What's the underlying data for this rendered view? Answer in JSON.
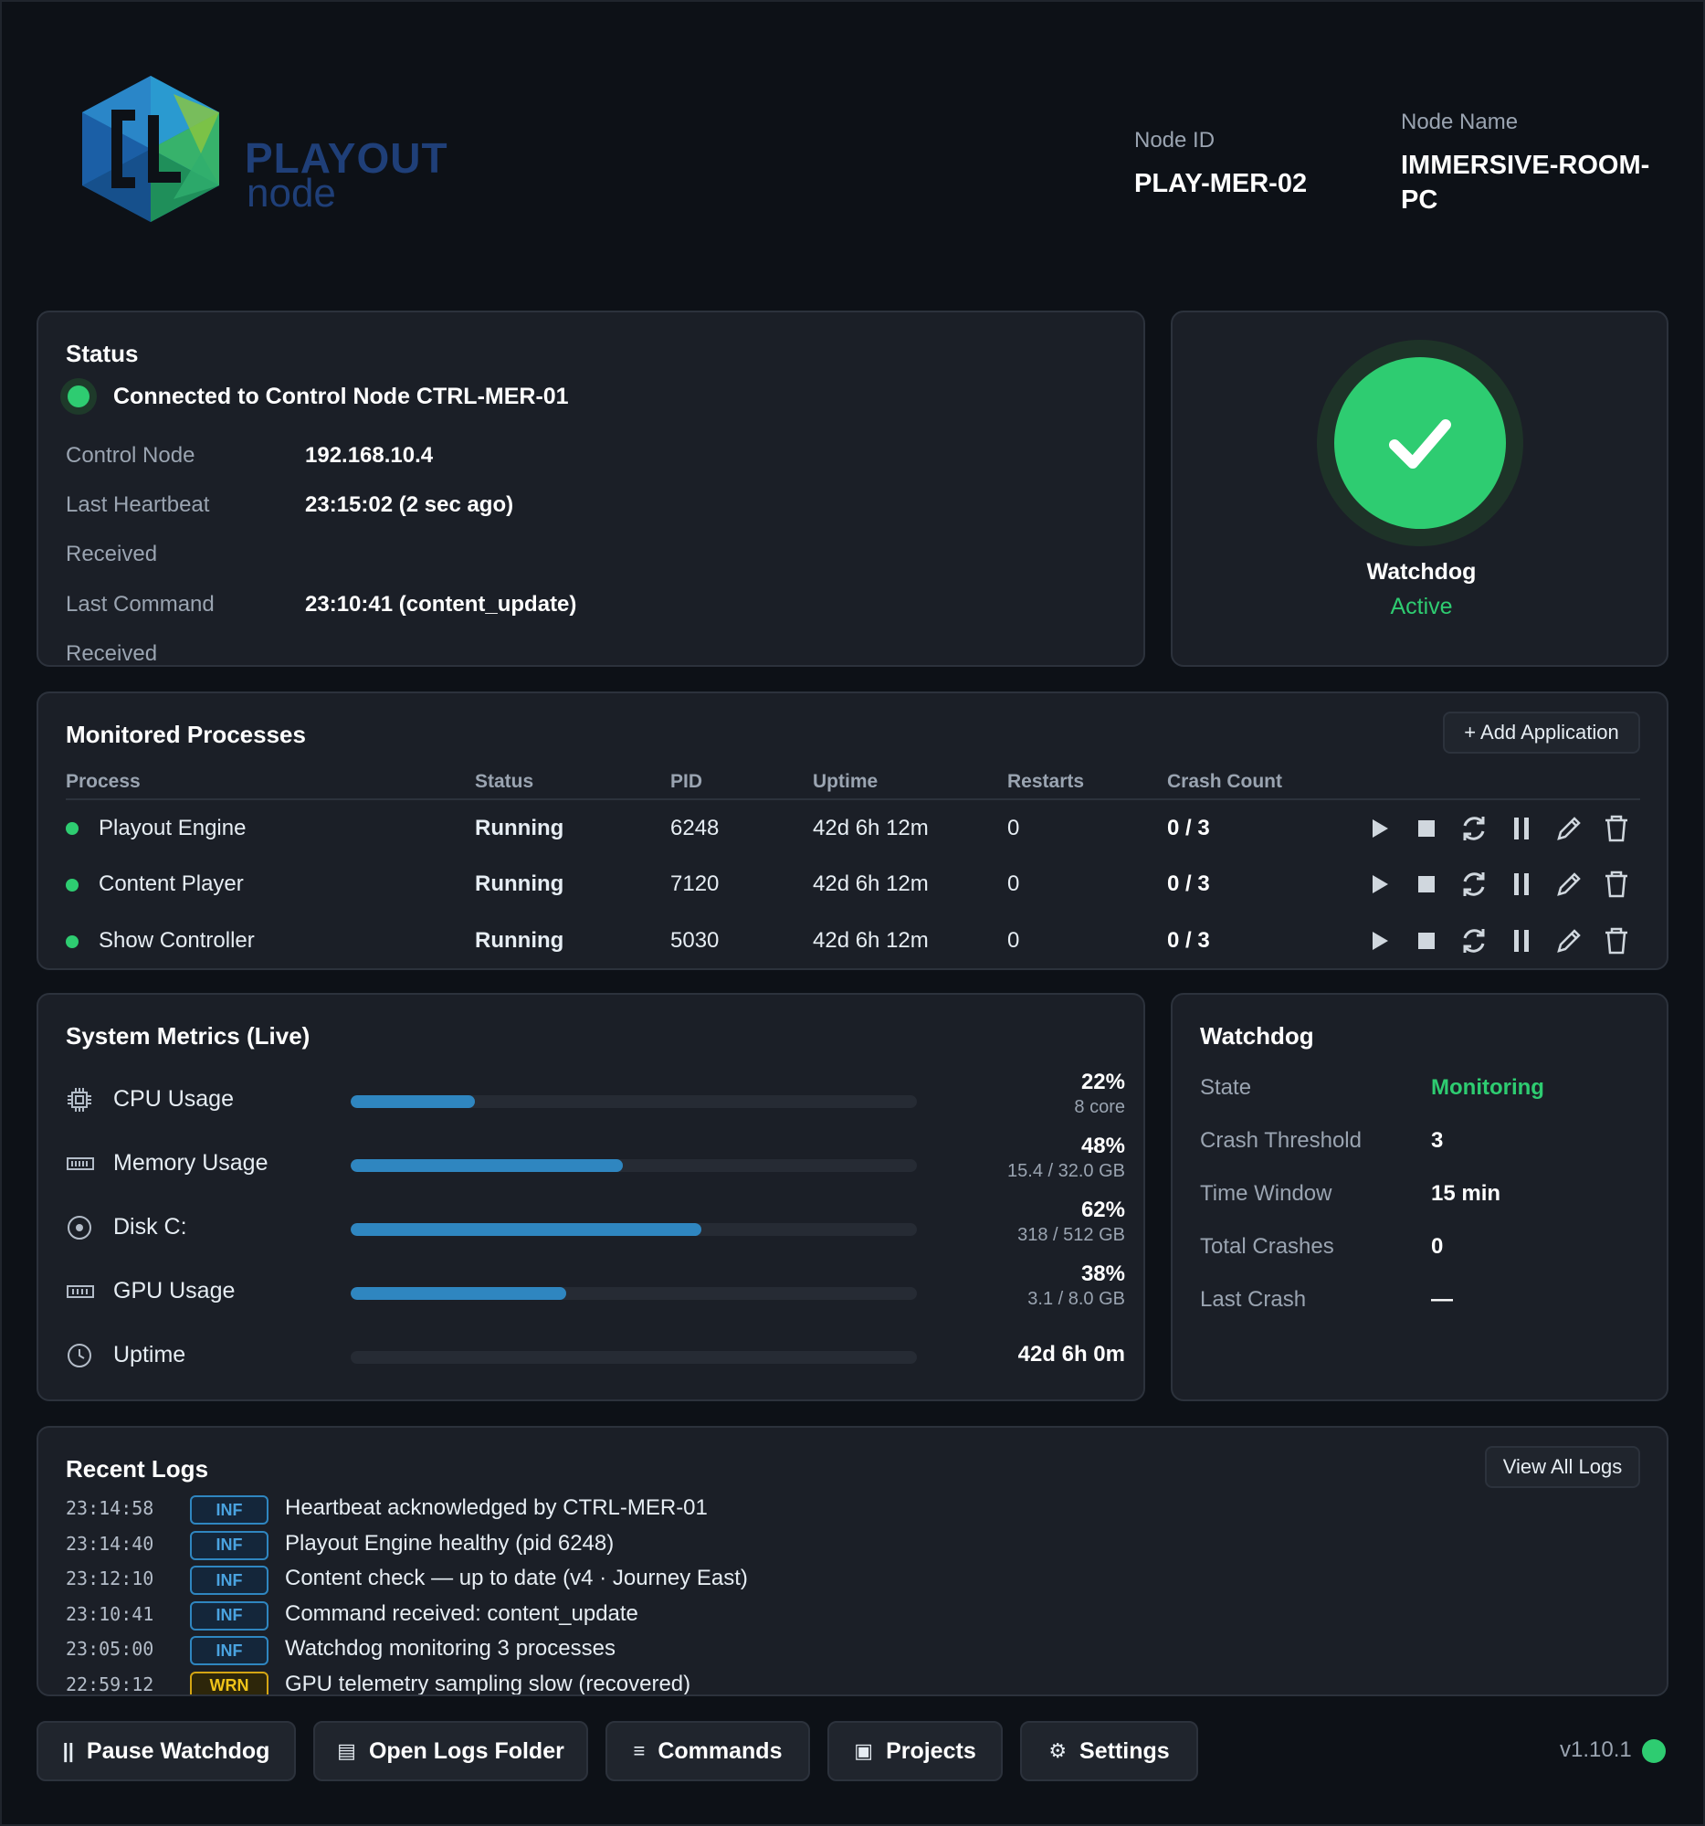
{
  "header": {
    "logo_word": "PLAYOUT",
    "logo_sub": "node",
    "node_id_label": "Node ID",
    "node_id": "PLAY-MER-02",
    "node_name_label": "Node Name",
    "node_name": "IMMERSIVE-ROOM-PC"
  },
  "status": {
    "title": "Status",
    "connection": "Connected to Control Node CTRL-MER-01",
    "rows": [
      {
        "label": "Control Node",
        "value": "192.168.10.4"
      },
      {
        "label": "Last Heartbeat Received",
        "value": "23:15:02 (2 sec ago)"
      },
      {
        "label": "Last Command Received",
        "value": "23:10:41 (content_update)"
      }
    ]
  },
  "watchdog_badge": {
    "label": "Watchdog",
    "state": "Active",
    "icon": "check-icon"
  },
  "processes": {
    "title": "Monitored Processes",
    "add_button": "+ Add Application",
    "columns": [
      "Process",
      "Status",
      "PID",
      "Uptime",
      "Restarts",
      "Crash Count"
    ],
    "rows": [
      {
        "name": "Playout Engine",
        "status": "Running",
        "pid": "6248",
        "uptime": "42d 6h 12m",
        "restarts": "0",
        "crashes": "0 / 3"
      },
      {
        "name": "Content Player",
        "status": "Running",
        "pid": "7120",
        "uptime": "42d 6h 12m",
        "restarts": "0",
        "crashes": "0 / 3"
      },
      {
        "name": "Show Controller",
        "status": "Running",
        "pid": "5030",
        "uptime": "42d 6h 12m",
        "restarts": "0",
        "crashes": "0 / 3"
      }
    ],
    "actions": [
      "play-icon",
      "stop-icon",
      "restart-icon",
      "pause-icon",
      "edit-icon",
      "delete-icon"
    ]
  },
  "metrics": {
    "title": "System Metrics (Live)",
    "items": [
      {
        "name": "CPU Usage",
        "icon": "cpu-icon",
        "fraction": 0.22,
        "pct": "22%",
        "sub": "8 core"
      },
      {
        "name": "Memory Usage",
        "icon": "memory-icon",
        "fraction": 0.48,
        "pct": "48%",
        "sub": "15.4 / 32.0 GB"
      },
      {
        "name": "Disk C:",
        "icon": "disk-icon",
        "fraction": 0.62,
        "pct": "62%",
        "sub": "318 / 512 GB"
      },
      {
        "name": "GPU Usage",
        "icon": "gpu-icon",
        "fraction": 0.38,
        "pct": "38%",
        "sub": "3.1 / 8.0 GB"
      },
      {
        "name": "Uptime",
        "icon": "clock-icon",
        "fraction": 0,
        "pct": "42d 6h 0m",
        "sub": ""
      }
    ]
  },
  "watchdog": {
    "title": "Watchdog",
    "rows": [
      {
        "label": "State",
        "value": "Monitoring"
      },
      {
        "label": "Crash Threshold",
        "value": "3"
      },
      {
        "label": "Time Window",
        "value": "15 min"
      },
      {
        "label": "Total Crashes",
        "value": "0"
      },
      {
        "label": "Last Crash",
        "value": "—"
      }
    ],
    "state_color": "#2ecc71"
  },
  "logs": {
    "title": "Recent Logs",
    "view_all": "View All Logs",
    "entries": [
      {
        "time": "23:14:58",
        "level": "INF",
        "message": "Heartbeat acknowledged by CTRL-MER-01"
      },
      {
        "time": "23:14:40",
        "level": "INF",
        "message": "Playout Engine healthy (pid 6248)"
      },
      {
        "time": "23:12:10",
        "level": "INF",
        "message": "Content check — up to date (v4 · Journey East)"
      },
      {
        "time": "23:10:41",
        "level": "INF",
        "message": "Command received: content_update"
      },
      {
        "time": "23:05:00",
        "level": "INF",
        "message": "Watchdog monitoring 3 processes"
      },
      {
        "time": "22:59:12",
        "level": "WRN",
        "message": "GPU telemetry sampling slow (recovered)"
      }
    ]
  },
  "footer": {
    "buttons": [
      {
        "label": "Pause Watchdog",
        "icon": "pause-icon",
        "glyph": "||"
      },
      {
        "label": "Open Logs Folder",
        "icon": "folder-icon",
        "glyph": "▤"
      },
      {
        "label": "Commands",
        "icon": "list-icon",
        "glyph": "≡"
      },
      {
        "label": "Projects",
        "icon": "projects-icon",
        "glyph": "▣"
      },
      {
        "label": "Settings",
        "icon": "gear-icon",
        "glyph": "⚙"
      }
    ],
    "version": "v1.10.1"
  },
  "colors": {
    "accent_green": "#2ecc71",
    "bar_blue": "#2f86c0",
    "info_blue": "#4aa3e0",
    "warn_yellow": "#f0c419",
    "background": "#0d1117",
    "panel": "#1b1f27"
  }
}
